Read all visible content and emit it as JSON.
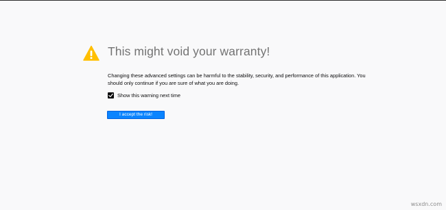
{
  "page": {
    "title": "This might void your warranty!",
    "description": "Changing these advanced settings can be harmful to the stability, security, and performance of this application. You should only continue if you are sure of what you are doing.",
    "checkbox": {
      "label": "Show this warning next time",
      "checked": true
    },
    "accept_button_label": "I accept the risk!",
    "icon": "warning-triangle-icon",
    "colors": {
      "background": "#f9f9fa",
      "title": "#737373",
      "button": "#0a84ff",
      "warning": "#ffbf00"
    }
  },
  "watermark": "wsxdn.com"
}
